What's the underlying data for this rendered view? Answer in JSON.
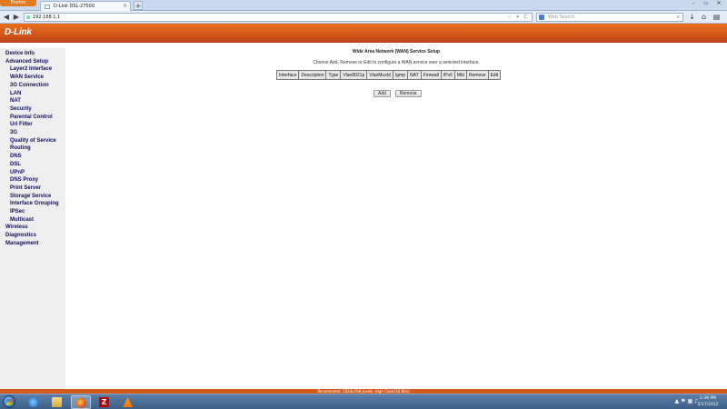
{
  "browser": {
    "firefox_button": "Firefox",
    "tab_title": "D-Link DSL-2750U",
    "url": "192.168.1.1",
    "search_placeholder": "Web Search"
  },
  "header": {
    "logo": "D-Link"
  },
  "sidebar": {
    "items": [
      {
        "label": "Device Info",
        "level": 1
      },
      {
        "label": "Advanced Setup",
        "level": 1
      },
      {
        "label": "Layer2 Interface",
        "level": 2
      },
      {
        "label": "WAN Service",
        "level": 2
      },
      {
        "label": "3G Connection",
        "level": 2
      },
      {
        "label": "LAN",
        "level": 2
      },
      {
        "label": "NAT",
        "level": 2
      },
      {
        "label": "Security",
        "level": 2
      },
      {
        "label": "Parental Control",
        "level": 2
      },
      {
        "label": "Url Filter",
        "level": 2
      },
      {
        "label": "3G",
        "level": 2
      },
      {
        "label": "Quality of Service",
        "level": 2
      },
      {
        "label": "Routing",
        "level": 2
      },
      {
        "label": "DNS",
        "level": 2
      },
      {
        "label": "DSL",
        "level": 2
      },
      {
        "label": "UPnP",
        "level": 2
      },
      {
        "label": "DNS Proxy",
        "level": 2
      },
      {
        "label": "Print Server",
        "level": 2
      },
      {
        "label": "Storage Service",
        "level": 2
      },
      {
        "label": "Interface Grouping",
        "level": 2
      },
      {
        "label": "IPSec",
        "level": 2
      },
      {
        "label": "Multicast",
        "level": 2
      },
      {
        "label": "Wireless",
        "level": 1
      },
      {
        "label": "Diagnostics",
        "level": 1
      },
      {
        "label": "Management",
        "level": 1
      }
    ]
  },
  "main": {
    "title": "Wide Area Network (WAN) Service Setup",
    "description": "Choose Add, Remove or Edit to configure a WAN service over a selected interface.",
    "table_headers": [
      "Interface",
      "Description",
      "Type",
      "Vlan8021p",
      "VlanMuxId",
      "Igmp",
      "NAT",
      "Firewall",
      "IPv6",
      "Mld",
      "Remove",
      "Edit"
    ],
    "add_label": "Add",
    "remove_label": "Remove"
  },
  "statusbar": {
    "text": "Recommend: 1024x768 pixels, High Color(16 Bits)"
  },
  "taskbar": {
    "time": "1:38 PM",
    "date": "5/17/2012"
  }
}
